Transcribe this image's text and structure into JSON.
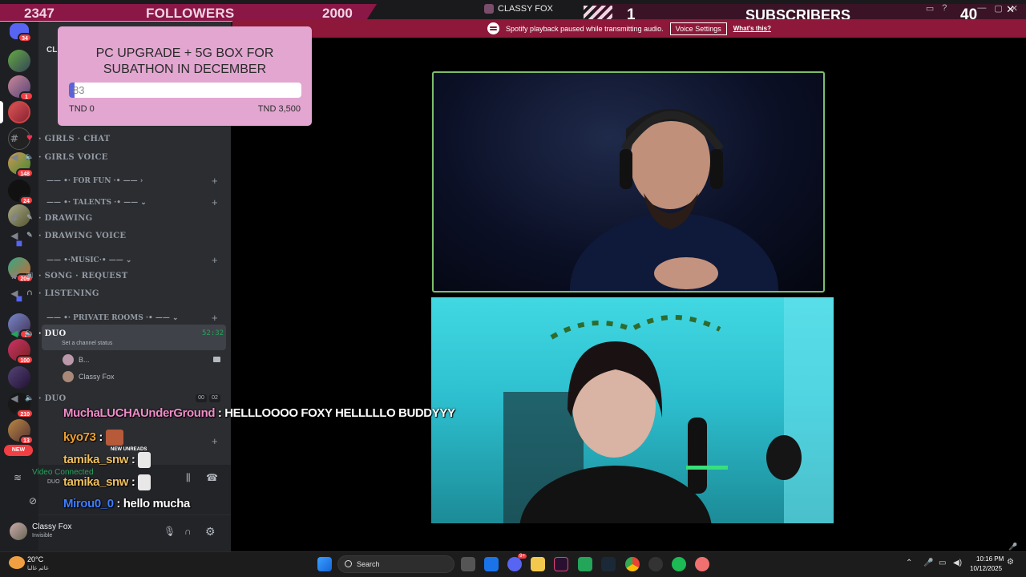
{
  "top_overlay": {
    "followers_current": "2347",
    "followers_label": "FOLLOWERS",
    "followers_goal": "2000",
    "subscribers_current": "1",
    "subscribers_label": "SUBSCRIBERS",
    "subscribers_goal": "40",
    "window_title": "CLASSY FOX"
  },
  "notice": {
    "text": "Spotify playback paused while transmitting audio.",
    "button": "Voice Settings",
    "link": "What's this?"
  },
  "goal": {
    "title_line1": "PC UPGRADE + 5G BOX FOR",
    "title_line2": "SUBATHON IN DECEMBER",
    "value": "83",
    "min": "TND 0",
    "max": "TND 3,500",
    "progress_fraction": 0.024,
    "color": "#e2a6d0"
  },
  "servers": {
    "badges": [
      "34",
      "1",
      "148",
      "24",
      "209",
      "2",
      "100",
      "210",
      "13"
    ],
    "new": "NEW"
  },
  "sidebar": {
    "header": "CL",
    "girls_chat": "· GIRLS · CHAT",
    "girls_voice": "· GIRLS VOICE",
    "cat_for_fun": "—— •· FOR FUN ·• —— ›",
    "cat_talents": "—— •· TALENTS ·• —— ⌄",
    "drawing": "· DRAWING",
    "drawing_voice": "· DRAWING VOICE",
    "cat_music": "—— •·MUSIC·• —— ⌄",
    "song_request": "· SONG · REQUEST",
    "listening": "· LISTENING",
    "cat_private": "—— •· PRIVATE ROOMS ·• —— ⌄",
    "duo_active": "· DUO",
    "duo_timer": "52:32",
    "duo_status": "Set a channel status",
    "member1": "B...",
    "member2": "Classy Fox",
    "duo2": "· DUO",
    "duo2_a": "00",
    "duo2_b": "02",
    "new_unreads": "NEW UNREADS"
  },
  "voice_panel": {
    "connected": "Video Connected",
    "channel": "DUO"
  },
  "user_panel": {
    "name": "Classy Fox",
    "status": "Invisible"
  },
  "chat": [
    {
      "user": "MuchaLUCHAUnderGround",
      "message": " : HELLLOOOO FOXY HELLLLLO BUDDYYY",
      "color": "#f08cc8"
    },
    {
      "user": "kyo73",
      "message": " :",
      "color": "#f0a030"
    },
    {
      "user": "tamika_snw",
      "message": " :",
      "color": "#f0c060"
    },
    {
      "user": "tamika_snw",
      "message": " :",
      "color": "#f0c060"
    },
    {
      "user": "Mirou0_0",
      "message": " : hello mucha",
      "color": "#3f7dff"
    }
  ],
  "taskbar": {
    "temp": "20°C",
    "weather": "غائم غالبا",
    "search": "Search",
    "time": "10:16 PM",
    "date": "10/12/2025",
    "outlook_badge": "9+"
  }
}
